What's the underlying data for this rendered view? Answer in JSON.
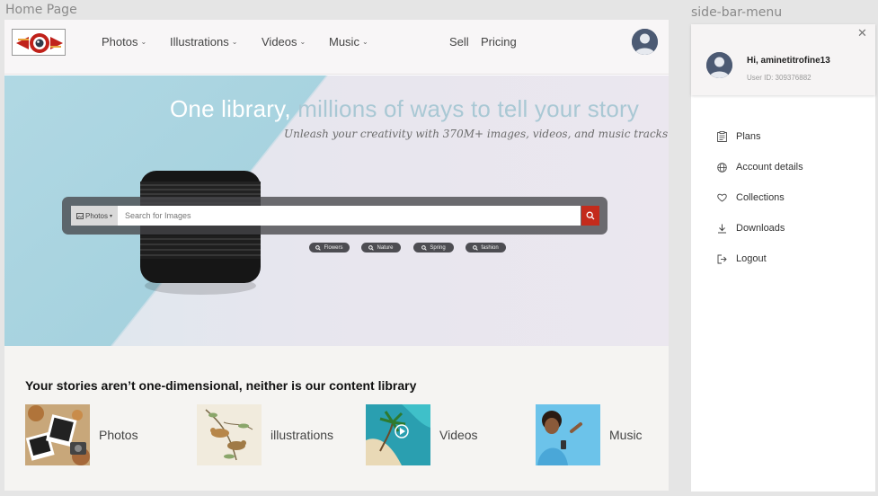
{
  "frames": {
    "home_label": "Home Page",
    "side_label": "side-bar-menu"
  },
  "nav": {
    "items": [
      {
        "label": "Photos",
        "dropdown": true
      },
      {
        "label": "Illustrations",
        "dropdown": true
      },
      {
        "label": "Videos",
        "dropdown": true
      },
      {
        "label": "Music",
        "dropdown": true
      },
      {
        "label": "Sell",
        "dropdown": false
      },
      {
        "label": "Pricing",
        "dropdown": false
      }
    ],
    "avatar_icon": "user-avatar-icon"
  },
  "hero": {
    "title_part1": "One library,",
    "title_part2": " millions of ways to tell your story",
    "subtitle": "Unleash your creativity with 370M+ images, videos, and music tracks.",
    "search": {
      "type_label": "Photos",
      "placeholder": "Search for Images"
    },
    "tags": [
      "Flowers",
      "Nature",
      "Spring",
      "fashion"
    ]
  },
  "stories": {
    "title": "Your stories aren’t one-dimensional, neither is our content library",
    "categories": [
      {
        "label": "Photos"
      },
      {
        "label": "illustrations"
      },
      {
        "label": "Videos"
      },
      {
        "label": "Music"
      }
    ]
  },
  "sidebar": {
    "greeting": "Hi, aminetitrofine13",
    "user_id": "User ID: 309376882",
    "menu": [
      {
        "label": "Plans",
        "icon": "clipboard-icon"
      },
      {
        "label": "Account details",
        "icon": "globe-icon"
      },
      {
        "label": "Collections",
        "icon": "heart-icon"
      },
      {
        "label": "Downloads",
        "icon": "download-icon"
      },
      {
        "label": "Logout",
        "icon": "logout-icon"
      }
    ]
  },
  "colors": {
    "accent": "#c42b1c",
    "hero_blue": "#a9d4e0",
    "title_blue": "#a9c8d4"
  }
}
